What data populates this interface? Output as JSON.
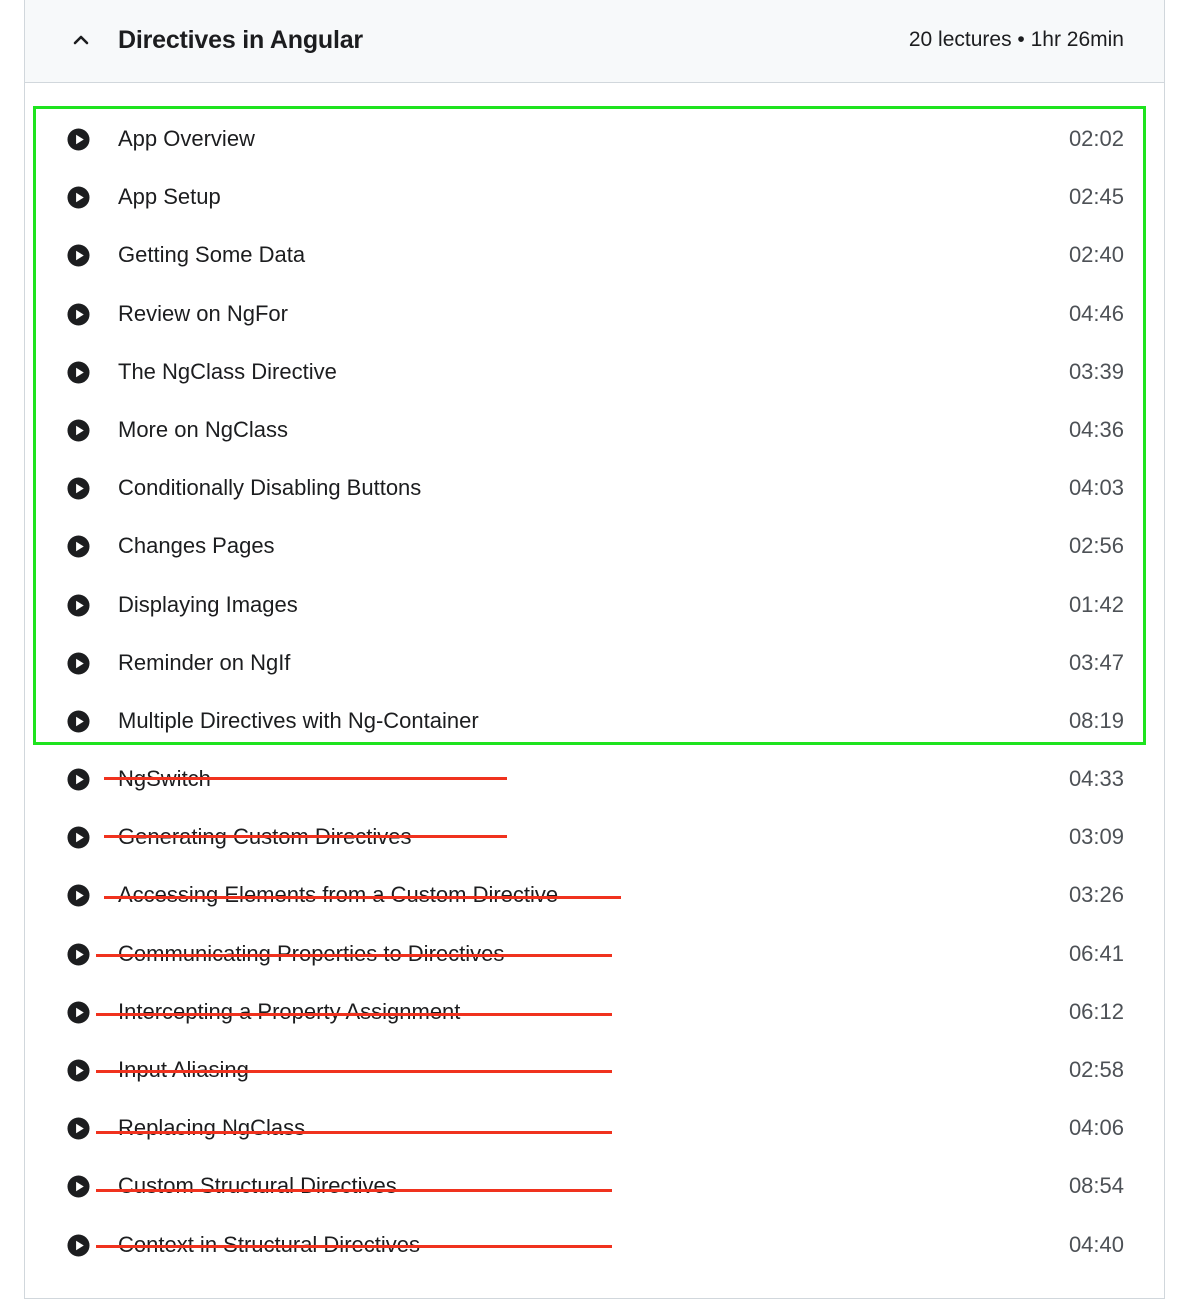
{
  "section": {
    "title": "Directives in Angular",
    "meta": "20 lectures • 1hr 26min",
    "collapse_icon": "chevron-up-icon"
  },
  "lectures": [
    {
      "title": "App Overview",
      "duration": "02:02",
      "icon": "play-circle-icon"
    },
    {
      "title": "App Setup",
      "duration": "02:45",
      "icon": "play-circle-icon"
    },
    {
      "title": "Getting Some Data",
      "duration": "02:40",
      "icon": "play-circle-icon"
    },
    {
      "title": "Review on NgFor",
      "duration": "04:46",
      "icon": "play-circle-icon"
    },
    {
      "title": "The NgClass Directive",
      "duration": "03:39",
      "icon": "play-circle-icon"
    },
    {
      "title": "More on NgClass",
      "duration": "04:36",
      "icon": "play-circle-icon"
    },
    {
      "title": "Conditionally Disabling Buttons",
      "duration": "04:03",
      "icon": "play-circle-icon"
    },
    {
      "title": "Changes Pages",
      "duration": "02:56",
      "icon": "play-circle-icon"
    },
    {
      "title": "Displaying Images",
      "duration": "01:42",
      "icon": "play-circle-icon"
    },
    {
      "title": "Reminder on NgIf",
      "duration": "03:47",
      "icon": "play-circle-icon"
    },
    {
      "title": "Multiple Directives with Ng-Container",
      "duration": "08:19",
      "icon": "play-circle-icon"
    },
    {
      "title": "NgSwitch",
      "duration": "04:33",
      "icon": "play-circle-icon"
    },
    {
      "title": "Generating Custom Directives",
      "duration": "03:09",
      "icon": "play-circle-icon"
    },
    {
      "title": "Accessing Elements from a Custom Directive",
      "duration": "03:26",
      "icon": "play-circle-icon"
    },
    {
      "title": "Communicating Properties to Directives",
      "duration": "06:41",
      "icon": "play-circle-icon"
    },
    {
      "title": "Intercepting a Property Assignment",
      "duration": "06:12",
      "icon": "play-circle-icon"
    },
    {
      "title": "Input Aliasing",
      "duration": "02:58",
      "icon": "play-circle-icon"
    },
    {
      "title": "Replacing NgClass",
      "duration": "04:06",
      "icon": "play-circle-icon"
    },
    {
      "title": "Custom Structural Directives",
      "duration": "08:54",
      "icon": "play-circle-icon"
    },
    {
      "title": "Context in Structural Directives",
      "duration": "04:40",
      "icon": "play-circle-icon"
    }
  ],
  "annotations": {
    "highlight_color": "#1ee31e",
    "strike_color": "#f0321e"
  }
}
